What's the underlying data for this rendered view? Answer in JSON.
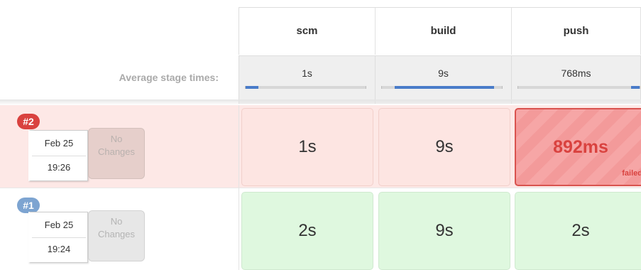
{
  "stages": [
    {
      "name": "scm"
    },
    {
      "name": "build"
    },
    {
      "name": "push"
    }
  ],
  "average": {
    "label": "Average stage times:",
    "values": [
      "1s",
      "9s",
      "768ms"
    ],
    "bar_fraction": [
      0.1,
      1.0,
      0.08
    ]
  },
  "builds": [
    {
      "number": "#2",
      "status": "failed",
      "badge_color": "#d9423f",
      "date": "Feb 25",
      "time": "19:26",
      "changes": "No\nChanges",
      "stage_times": [
        "1s",
        "9s",
        "892ms"
      ],
      "stage_status": [
        "success-warn",
        "success-warn",
        "failed"
      ],
      "failed_label": "failed"
    },
    {
      "number": "#1",
      "status": "success",
      "badge_color": "#7da4d1",
      "date": "Feb 25",
      "time": "19:24",
      "changes": "No\nChanges",
      "stage_times": [
        "2s",
        "9s",
        "2s"
      ],
      "stage_status": [
        "success",
        "success",
        "success"
      ]
    }
  ],
  "colors": {
    "failed_row": "#fde8e6",
    "failed_cell": "#f6a6a6",
    "success_cell": "#dff8df",
    "progress_fill": "#4a7cc9"
  }
}
